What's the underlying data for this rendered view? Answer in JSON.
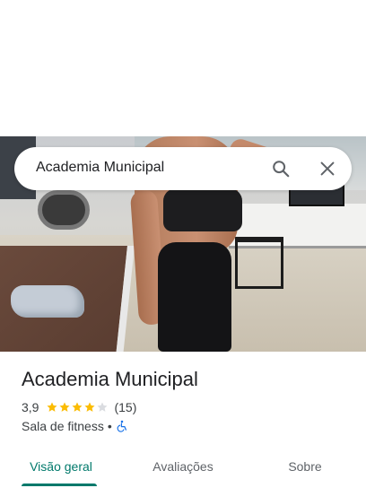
{
  "search": {
    "query": "Academia Municipal",
    "search_icon": "search-icon",
    "close_icon": "close-icon"
  },
  "place": {
    "name": "Academia Municipal",
    "rating": "3,9",
    "stars_filled": 4,
    "stars_total": 5,
    "review_count": "(15)",
    "category": "Sala de fitness",
    "separator": "•",
    "accessibility_icon": "wheelchair-icon"
  },
  "tabs": [
    {
      "label": "Visão geral",
      "active": true
    },
    {
      "label": "Avaliações",
      "active": false
    },
    {
      "label": "Sobre",
      "active": false
    }
  ],
  "colors": {
    "accent": "#00796b",
    "star": "#fbbc04",
    "star_empty": "#dadce0",
    "access_icon": "#1a73e8"
  }
}
